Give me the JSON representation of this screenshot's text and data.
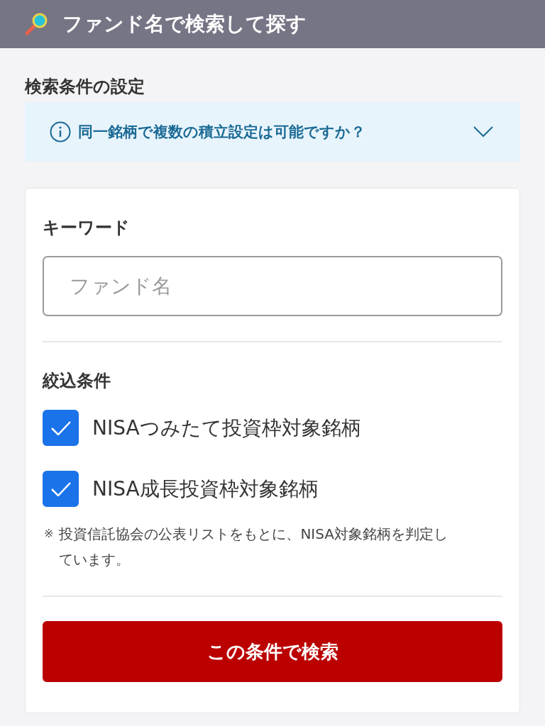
{
  "header": {
    "title": "ファンド名で検索して探す"
  },
  "section_title": "検索条件の設定",
  "faq": {
    "question": "同一銘柄で複数の積立設定は可能ですか？",
    "expanded": false
  },
  "form": {
    "keyword": {
      "label": "キーワード",
      "placeholder": "ファンド名"
    },
    "filters": {
      "title": "絞込条件",
      "options": [
        {
          "label": "NISAつみたて投資枠対象銘柄",
          "checked": true
        },
        {
          "label": "NISA成長投資枠対象銘柄",
          "checked": true
        }
      ],
      "note_mark": "※",
      "note": "投資信託協会の公表リストをもとに、NISA対象銘柄を判定しています。"
    },
    "submit": "この条件で検索"
  }
}
